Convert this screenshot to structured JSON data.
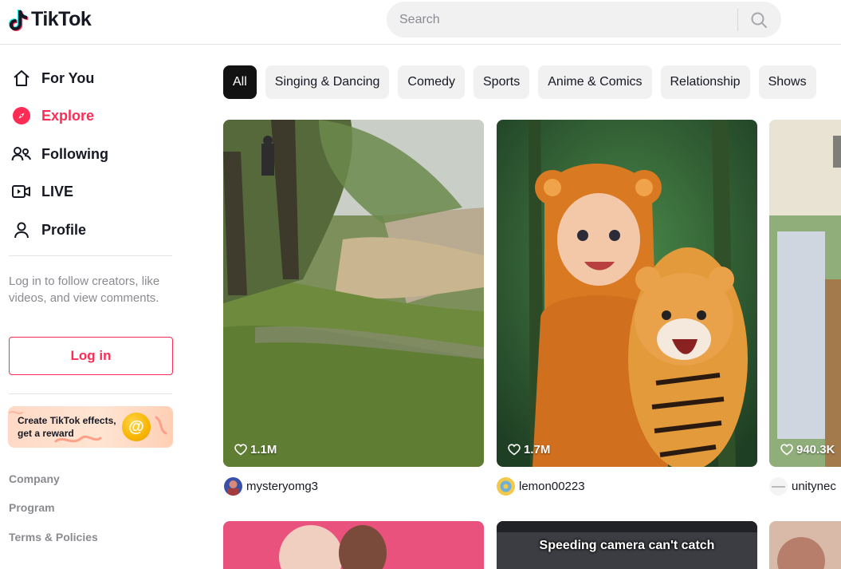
{
  "header": {
    "logo_text": "TikTok",
    "search_placeholder": "Search"
  },
  "sidebar": {
    "nav": [
      {
        "label": "For You",
        "icon": "home-icon",
        "active": false
      },
      {
        "label": "Explore",
        "icon": "compass-icon",
        "active": true
      },
      {
        "label": "Following",
        "icon": "following-users-icon",
        "active": false
      },
      {
        "label": "LIVE",
        "icon": "live-video-icon",
        "active": false
      },
      {
        "label": "Profile",
        "icon": "user-icon",
        "active": false
      }
    ],
    "login_hint": "Log in to follow creators, like videos, and view comments.",
    "login_button": "Log in",
    "effects_banner": {
      "text": "Create TikTok effects, get a reward",
      "coin_glyph": "@"
    },
    "footer_links": [
      "Company",
      "Program",
      "Terms & Policies"
    ]
  },
  "categories": [
    "All",
    "Singing & Dancing",
    "Comedy",
    "Sports",
    "Anime & Comics",
    "Relationship",
    "Shows"
  ],
  "active_category": "All",
  "videos": [
    {
      "likes": "1.1M",
      "author": "mysteryomg3"
    },
    {
      "likes": "1.7M",
      "author": "lemon00223"
    },
    {
      "likes": "940.3K",
      "author": "unitynec"
    }
  ],
  "second_row": [
    {
      "caption": ""
    },
    {
      "caption": "Speeding camera can't catch"
    },
    {
      "caption": ""
    }
  ],
  "colors": {
    "accent": "#fe2c55",
    "text": "#161823",
    "muted": "#8a8b91",
    "chip_bg": "#f1f1f2",
    "chip_active_bg": "#121212"
  }
}
